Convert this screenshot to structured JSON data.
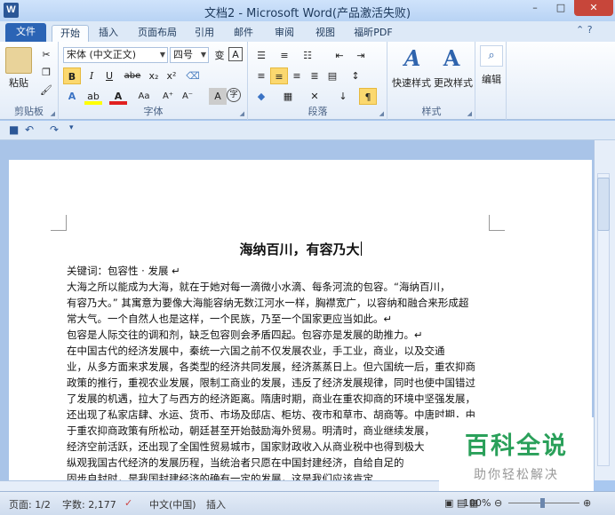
{
  "window": {
    "title": "文档2 - Microsoft Word(产品激活失败)",
    "app_icon": "W",
    "minimize": "–",
    "maximize": "□",
    "close": "✕"
  },
  "tabs": [
    "文件",
    "开始",
    "插入",
    "页面布局",
    "引用",
    "邮件",
    "审阅",
    "视图",
    "福昕PDF"
  ],
  "ribbon": {
    "clipboard": {
      "paste": "粘贴",
      "label": "剪贴板"
    },
    "font": {
      "name": "宋体 (中文正文)",
      "size": "四号",
      "label": "字体",
      "bold": "B",
      "italic": "I",
      "underline": "U",
      "strike": "abe",
      "sub": "x₂",
      "sup": "x²",
      "grow": "A⁺",
      "shrink": "A⁻",
      "aa": "Aa",
      "phonetic": "变",
      "border": "A",
      "char_shade": "A",
      "enclose": "字"
    },
    "paragraph": {
      "label": "段落"
    },
    "styles": {
      "quick": "快速样式",
      "change": "更改样式",
      "label": "样式"
    },
    "editing": {
      "label": "编辑"
    }
  },
  "document": {
    "title": "海纳百川，有容乃大",
    "lines": [
      "关键词：包容性 · 发展 ↵",
      "    大海之所以能成为大海，就在于她对每一滴微小水滴、每条河流的包容。“海纳百川，",
      "有容乃大。” 其寓意为要像大海能容纳无数江河水一样，胸襟宽广，以容纳和融合来形成超",
      "常大气。一个自然人也是这样，一个民族，乃至一个国家更应当如此。↵",
      "    包容是人际交往的调和剂，缺乏包容则会矛盾四起。包容亦是发展的助推力。↵",
      "    在中国古代的经济发展中，秦统一六国之前不仅发展农业，手工业，商业，以及交通",
      "业，从多方面来求发展，各类型的经济共同发展，经济蒸蒸日上。但六国统一后，重农抑商",
      "政策的推行，重视农业发展，限制工商业的发展，违反了经济发展规律，同时也使中国错过",
      "了发展的机遇，拉大了与西方的经济距离。隋唐时期，商业在重农抑商的环境中坚强发展，",
      "还出现了私家店肆、水运、货币、市场及邸店、柜坊、夜市和草市、胡商等。中唐时期，由",
      "于重农抑商政策有所松动，朝廷甚至开始鼓励海外贸易。明清时，商业继续发展，",
      "经济空前活跃，还出现了全国性贸易城市，国家财政收入从商业税中也得到极大",
      "    纵观我国古代经济的发展历程，当统治者只愿在中国封建经济，自给自足的",
      "固步自封时，是我国封建经济的确有一定的发展，这是我们应该肯定"
    ]
  },
  "status": {
    "page": "页面: 1/2",
    "words": "字数: 2,177",
    "lang": "中文(中国)",
    "mode": "插入",
    "zoom": "100%"
  },
  "watermark": {
    "big": "百科全说",
    "small": "助你轻松解决"
  }
}
